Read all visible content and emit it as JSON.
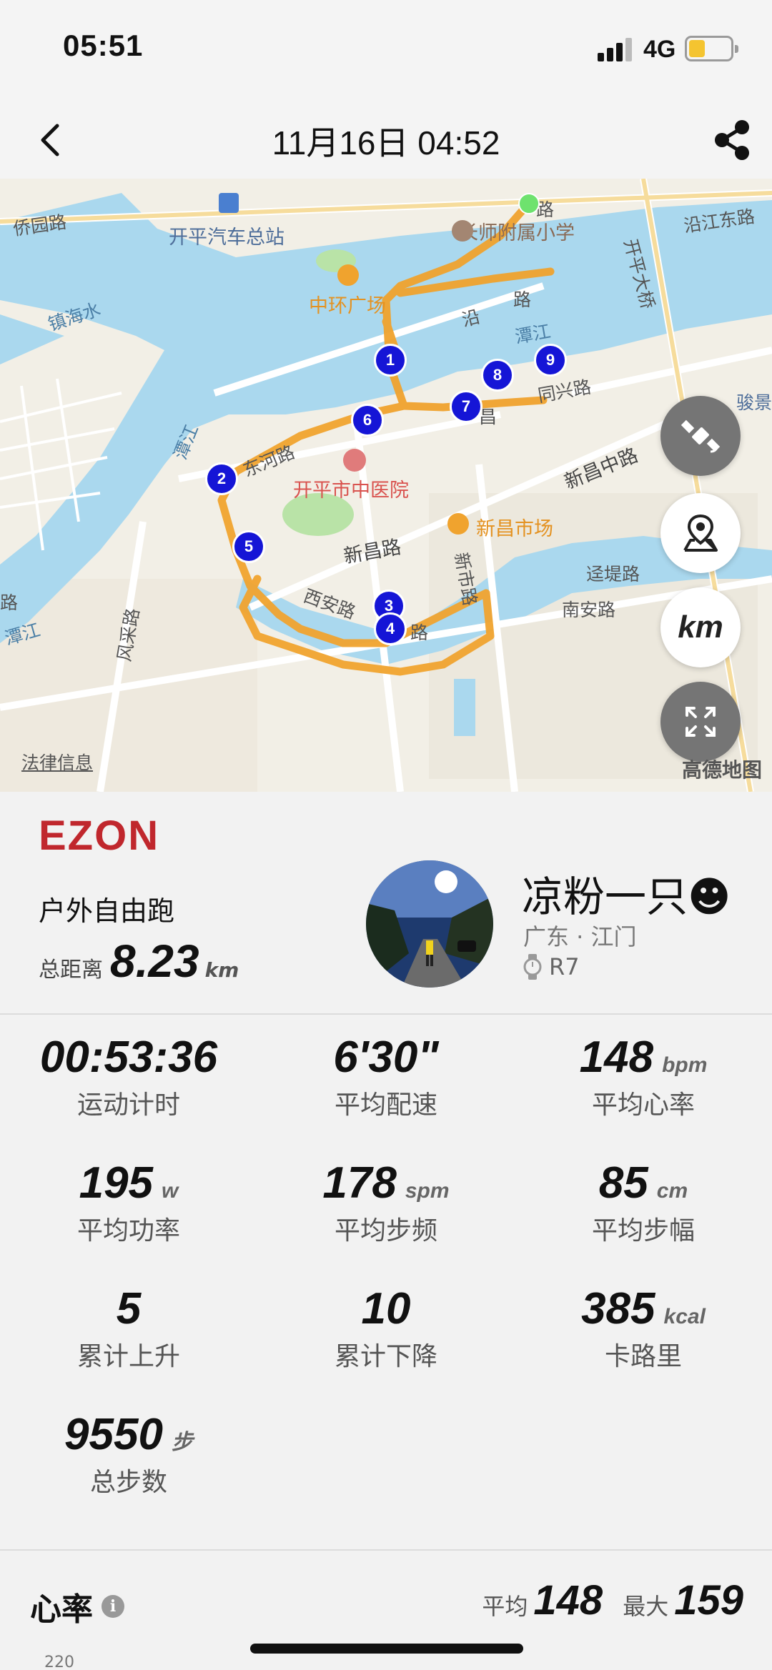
{
  "status_bar": {
    "time": "05:51",
    "network": "4G"
  },
  "header": {
    "title": "11月16日 04:52"
  },
  "map": {
    "labels": {
      "qiaoyuan": "侨园路",
      "bus_station": "开平汽车总站",
      "school": "长师附属小学",
      "yanjiang_e": "沿江东路",
      "kaiping_bridge": "开平大桥",
      "zhenhai": "镇海水",
      "zhonghuan": "中环广场",
      "tanjiang1": "潭江",
      "tongxing": "同兴路",
      "jun": "骏景",
      "donghe": "东河路",
      "hospital": "开平市中医院",
      "tanjiang2": "潭江",
      "xinchang_market": "新昌市场",
      "xinchang_mid": "新昌中路",
      "xinchang_rd": "新昌路",
      "xinshi": "新市路",
      "didi": "迳堤路",
      "nanan": "南安路",
      "xian": "西安路",
      "tanjiang3": "潭江",
      "road_left": "路",
      "fengcai": "风采路",
      "lu": "路",
      "yan": "沿",
      "lu2": "路",
      "chang": "昌",
      "lu3": "路"
    },
    "markers": [
      "1",
      "2",
      "3",
      "4",
      "5",
      "6",
      "7",
      "8",
      "9"
    ],
    "buttons": {
      "satellite_icon": "satellite-icon",
      "location_icon": "location-pin-icon",
      "km_label": "km",
      "fullscreen_icon": "fullscreen-icon"
    },
    "legal": "法律信息",
    "provider": "高德地图",
    "colors": {
      "route": "#f0a32e",
      "water": "#aad8ee",
      "marker": "#1515d6",
      "start": "#6ee26e"
    }
  },
  "summary": {
    "brand": "EZON",
    "sport_type": "户外自由跑",
    "distance_label": "总距离",
    "distance_value": "8.23",
    "distance_unit": "km",
    "user_name": "凉粉一只☻",
    "location": "广东 · 江门",
    "device": "R7"
  },
  "metrics": [
    {
      "value": "00:53:36",
      "unit": "",
      "label": "运动计时"
    },
    {
      "value": "6'30\"",
      "unit": "",
      "label": "平均配速"
    },
    {
      "value": "148",
      "unit": "bpm",
      "label": "平均心率"
    },
    {
      "value": "195",
      "unit": "w",
      "label": "平均功率"
    },
    {
      "value": "178",
      "unit": "spm",
      "label": "平均步频"
    },
    {
      "value": "85",
      "unit": "cm",
      "label": "平均步幅"
    },
    {
      "value": "5",
      "unit": "",
      "label": "累计上升"
    },
    {
      "value": "10",
      "unit": "",
      "label": "累计下降"
    },
    {
      "value": "385",
      "unit": "kcal",
      "label": "卡路里"
    },
    {
      "value": "9550",
      "unit": "步",
      "label": "总步数"
    }
  ],
  "heart_rate": {
    "title": "心率",
    "avg_label": "平均",
    "avg_value": "148",
    "max_label": "最大",
    "max_value": "159",
    "axis_top": "220"
  }
}
